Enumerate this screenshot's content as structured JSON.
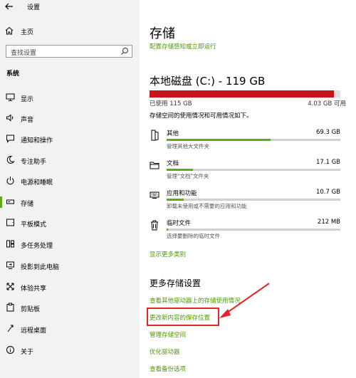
{
  "window": {
    "title": "设置"
  },
  "sidebar": {
    "home": "主页",
    "search_placeholder": "查找设置",
    "section": "系统",
    "items": [
      {
        "label": "显示",
        "icon": "monitor-icon"
      },
      {
        "label": "声音",
        "icon": "speaker-icon"
      },
      {
        "label": "通知和操作",
        "icon": "notification-icon"
      },
      {
        "label": "专注助手",
        "icon": "moon-icon"
      },
      {
        "label": "电源和睡眠",
        "icon": "power-icon"
      },
      {
        "label": "存储",
        "icon": "storage-icon",
        "selected": true
      },
      {
        "label": "平板模式",
        "icon": "tablet-icon"
      },
      {
        "label": "多任务处理",
        "icon": "multitask-icon"
      },
      {
        "label": "投影到此电脑",
        "icon": "project-icon"
      },
      {
        "label": "体验共享",
        "icon": "share-icon"
      },
      {
        "label": "剪贴板",
        "icon": "clipboard-icon"
      },
      {
        "label": "远程桌面",
        "icon": "remote-desktop-icon"
      },
      {
        "label": "关于",
        "icon": "info-icon"
      }
    ]
  },
  "main": {
    "title": "存储",
    "configure_link": "配置存储感知或立即运行",
    "disk": {
      "title": "本地磁盘 (C:) - 119 GB",
      "used_label": "已使用 115 GB",
      "free_label": "4.03 GB 可用",
      "used_fraction": 0.966
    },
    "usage_desc": "存储空间的使用情况和可用情况如下。",
    "categories": [
      {
        "name": "其他",
        "size": "69.3 GB",
        "desc": "管理其他大文件夹",
        "fraction": 0.6,
        "icon": "other-files-icon"
      },
      {
        "name": "文档",
        "size": "17.1 GB",
        "desc": "管理\"文档\"文件夹",
        "fraction": 0.15,
        "icon": "folder-icon"
      },
      {
        "name": "应用和功能",
        "size": "10.7 GB",
        "desc": "卸载未使用或不需要的应用和功能",
        "fraction": 0.1,
        "icon": "keyboard-icon"
      },
      {
        "name": "临时文件",
        "size": "212 MB",
        "desc": "选择要删除的临时文件",
        "fraction": 0.01,
        "icon": "trash-icon"
      }
    ],
    "show_more": "显示更多类别",
    "more_title": "更多存储设置",
    "more_links": [
      "查看其他驱动器上的存储使用情况",
      "更改新内容的保存位置",
      "管理存储空间",
      "优化驱动器",
      "查看备份选项"
    ]
  },
  "colors": {
    "accent": "#63a912",
    "link": "#4e9a06",
    "disk_used": "#c8151c",
    "annotation": "#e3262a"
  }
}
